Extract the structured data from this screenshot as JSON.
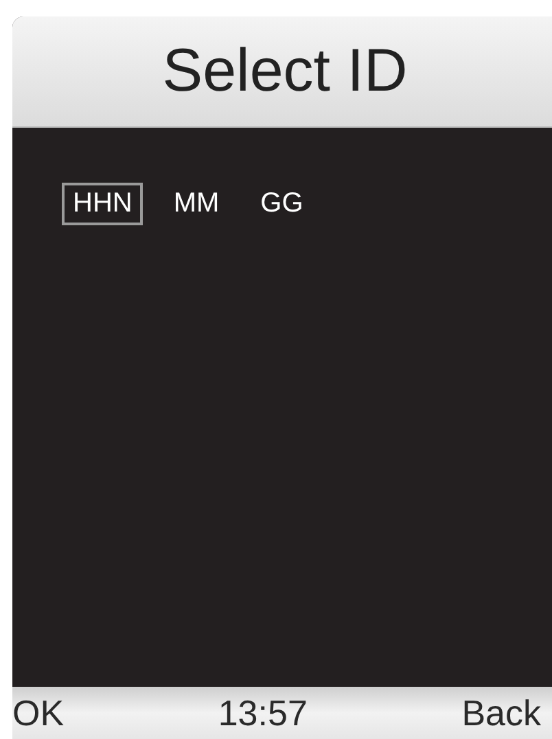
{
  "title": "Select ID",
  "ids": [
    {
      "label": "HHN",
      "selected": true
    },
    {
      "label": "MM",
      "selected": false
    },
    {
      "label": "GG",
      "selected": false
    }
  ],
  "softkeys": {
    "left": "OK",
    "center": "13:57",
    "right": "Back"
  }
}
